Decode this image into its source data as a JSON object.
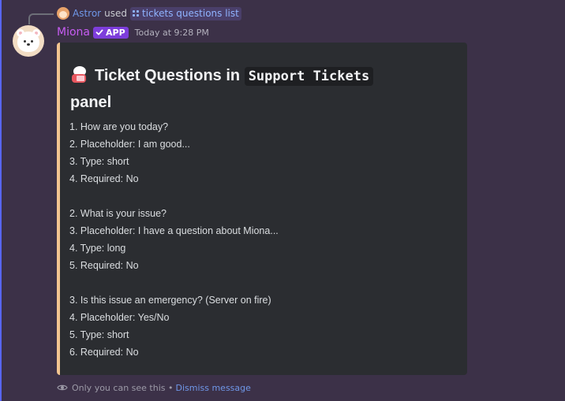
{
  "reply": {
    "user": "Astror",
    "used_text": "used",
    "command": "tickets questions list"
  },
  "message": {
    "author": "Miona",
    "badge": "APP",
    "timestamp": "Today at 9:28 PM"
  },
  "embed": {
    "title_prefix": "Ticket Questions in",
    "panel_name": "Support Tickets",
    "title_suffix": "panel",
    "accent_color": "#f2c490",
    "questions": [
      {
        "lines": [
          "1. How are you today?",
          "2. Placeholder: I am good...",
          "3. Type: short",
          "4. Required: No"
        ]
      },
      {
        "lines": [
          "2. What is your issue?",
          "3. Placeholder: I have a question about Miona...",
          "4. Type: long",
          "5. Required: No"
        ]
      },
      {
        "lines": [
          "3. Is this issue an emergency? (Server on fire)",
          "4. Placeholder: Yes/No",
          "5. Type: short",
          "6. Required: No"
        ]
      }
    ]
  },
  "footer": {
    "notice": "Only you can see this •",
    "dismiss_label": "Dismiss message"
  },
  "colors": {
    "background": "#3c3148",
    "embed_background": "#2b2d31",
    "username": "#c65cf2",
    "badge": "#7d3ddb",
    "link": "#6f97e8"
  },
  "icons": {
    "reply_avatar": "user-avatar-icon",
    "command": "slash-command-icon",
    "badge_check": "verified-check-icon",
    "title": "bear-emoji-icon",
    "visibility": "eye-icon"
  }
}
